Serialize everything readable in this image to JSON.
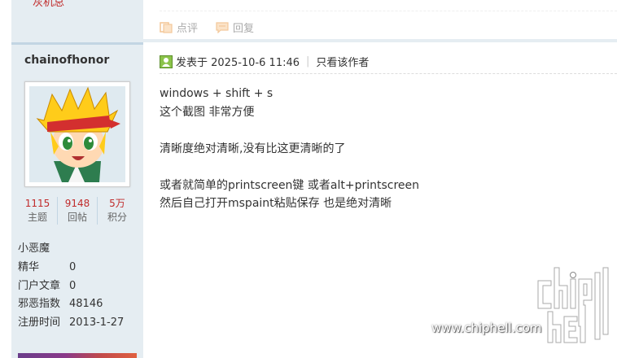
{
  "sidebar": {
    "top_link": "灰机总",
    "username": "chainofhonor",
    "stats": [
      {
        "value": "1115",
        "label": "主题"
      },
      {
        "value": "9148",
        "label": "回帖"
      },
      {
        "value": "5万",
        "label": "积分"
      }
    ],
    "user_group": "小恶魔",
    "profile": [
      {
        "label": "精华",
        "value": "0"
      },
      {
        "label": "门户文章",
        "value": "0"
      },
      {
        "label": "邪恶指数",
        "value": "48146"
      },
      {
        "label": "注册时间",
        "value": "2013-1-27"
      }
    ]
  },
  "prev_post": {
    "comment_label": "点评",
    "reply_label": "回复"
  },
  "post": {
    "posted_at": "发表于 2025-10-6 11:46",
    "only_author": "只看该作者",
    "lines": [
      "windows + shift + s",
      "这个截图 非常方便",
      "",
      "清晰度绝对清晰,没有比这更清晰的了",
      "",
      "或者就简单的printscreen键 或者alt+printscreen",
      "然后自己打开mspaint粘贴保存 也是绝对清晰"
    ]
  },
  "watermark": {
    "url": "www.chiphell.com"
  },
  "colors": {
    "sidebar_bg": "#e5edf2",
    "stat_number": "#c02b2b",
    "online_green": "#7cb342"
  }
}
